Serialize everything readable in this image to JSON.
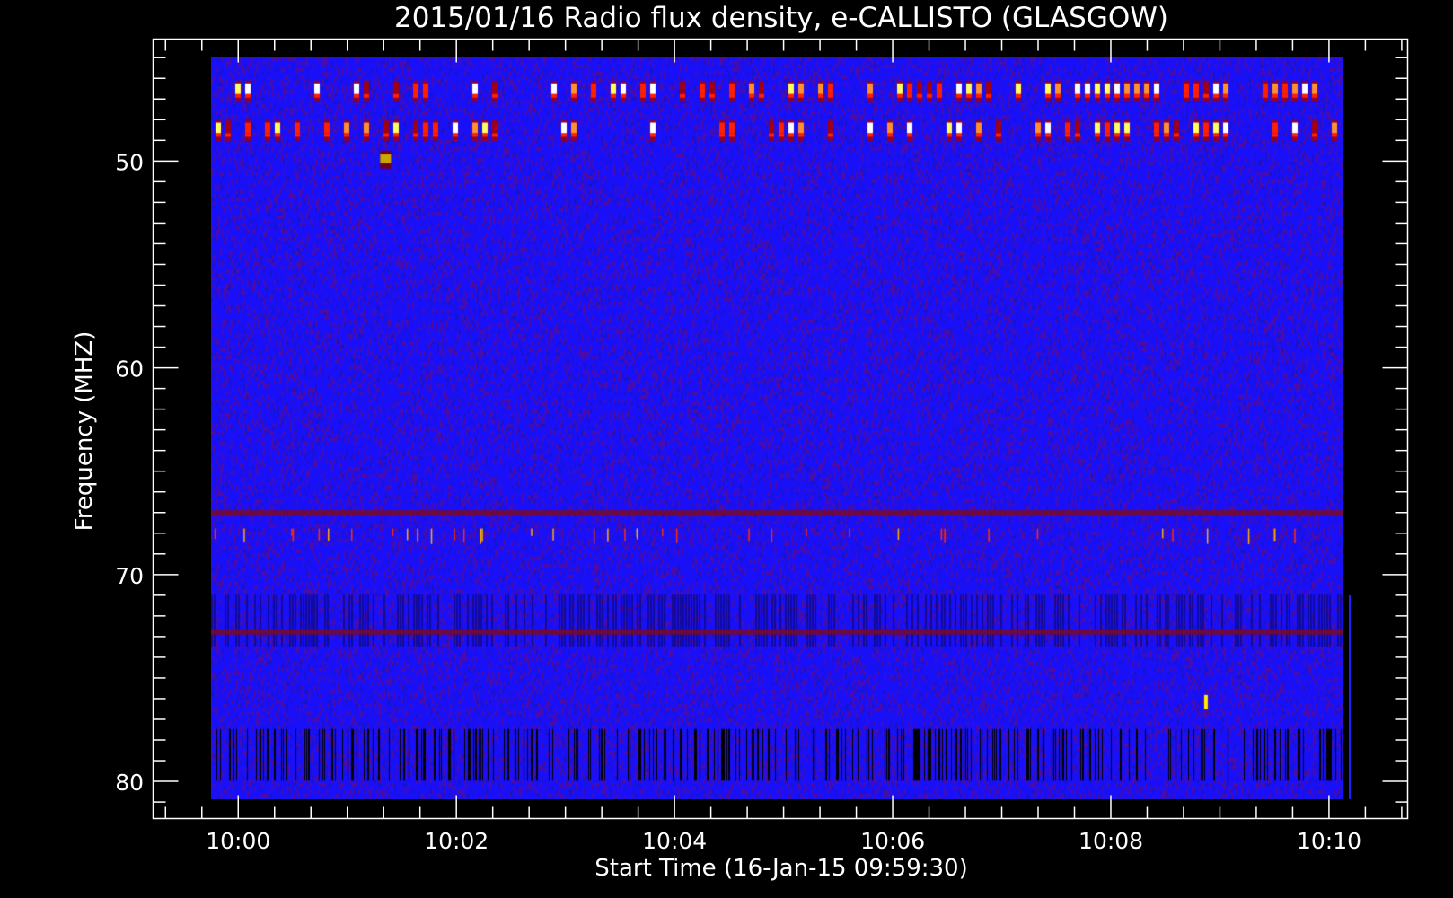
{
  "chart_data": {
    "type": "heatmap",
    "title": "2015/01/16  Radio flux density, e-CALLISTO (GLASGOW)",
    "xlabel": "Start Time (16-Jan-15 09:59:30)",
    "ylabel": "Frequency (MHZ)",
    "xlim_minutes_after_1000": [
      -0.78,
      10.72
    ],
    "ylim_mhz": [
      44.1,
      81.8
    ],
    "y_inverted": true,
    "data_extent": {
      "time_minutes_after_1000": [
        -0.25,
        10.13
      ],
      "freq_mhz": [
        45.0,
        80.9
      ]
    },
    "x_ticks": [
      {
        "value": 0,
        "label": "10:00"
      },
      {
        "value": 2,
        "label": "10:02"
      },
      {
        "value": 4,
        "label": "10:04"
      },
      {
        "value": 6,
        "label": "10:06"
      },
      {
        "value": 8,
        "label": "10:08"
      },
      {
        "value": 10,
        "label": "10:10"
      }
    ],
    "x_minor_step_minutes": 0.3333,
    "y_ticks": [
      {
        "value": 50,
        "label": "50"
      },
      {
        "value": 60,
        "label": "60"
      },
      {
        "value": 70,
        "label": "70"
      },
      {
        "value": 80,
        "label": "80"
      }
    ],
    "y_minor_step_mhz": 1,
    "features": {
      "burst_channels_mhz": [
        46.6,
        48.5
      ],
      "isolated_burst": {
        "time": 1.35,
        "freq": 49.9
      },
      "rfi_lines_mhz": [
        67.0,
        72.8
      ],
      "interference_band_mhz": [
        71.0,
        73.5
      ],
      "dropout_band_mhz": [
        77.5,
        80.0
      ],
      "late_event": {
        "time": 8.87,
        "freq": 76.2
      }
    },
    "colormap": [
      "#000000",
      "#8b0000",
      "#1a10ff",
      "#ff2000",
      "#ffa000",
      "#ffff40",
      "#ffffff"
    ],
    "grid": false
  }
}
